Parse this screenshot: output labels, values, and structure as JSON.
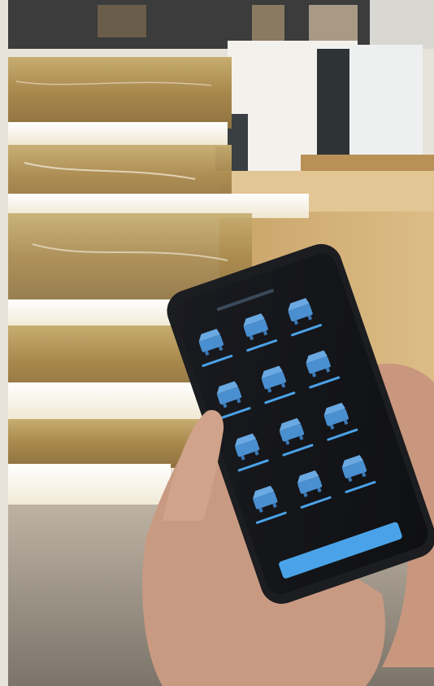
{
  "photo": {
    "subject": "hand-holding-smartphone-in-warehouse",
    "colors": {
      "roll_gold": "#b89a5e",
      "roll_highlight": "#f4efe2",
      "cardboard": "#d6b47a",
      "phone_body": "#1c1d20",
      "screen_bg": "#15161a",
      "tile_icon": "#4a8fd0",
      "underline": "#4aa3e8",
      "skin": "#c99a82"
    }
  },
  "phone_app": {
    "grid_rows": 4,
    "grid_cols": 3,
    "tiles": [
      {
        "icon": "machine-icon"
      },
      {
        "icon": "machine-icon"
      },
      {
        "icon": "machine-icon"
      },
      {
        "icon": "machine-icon"
      },
      {
        "icon": "machine-icon"
      },
      {
        "icon": "machine-icon"
      },
      {
        "icon": "machine-icon"
      },
      {
        "icon": "machine-icon"
      },
      {
        "icon": "machine-icon"
      },
      {
        "icon": "machine-icon"
      },
      {
        "icon": "machine-icon"
      },
      {
        "icon": "machine-icon"
      }
    ],
    "bottom_button_icon": "none"
  }
}
